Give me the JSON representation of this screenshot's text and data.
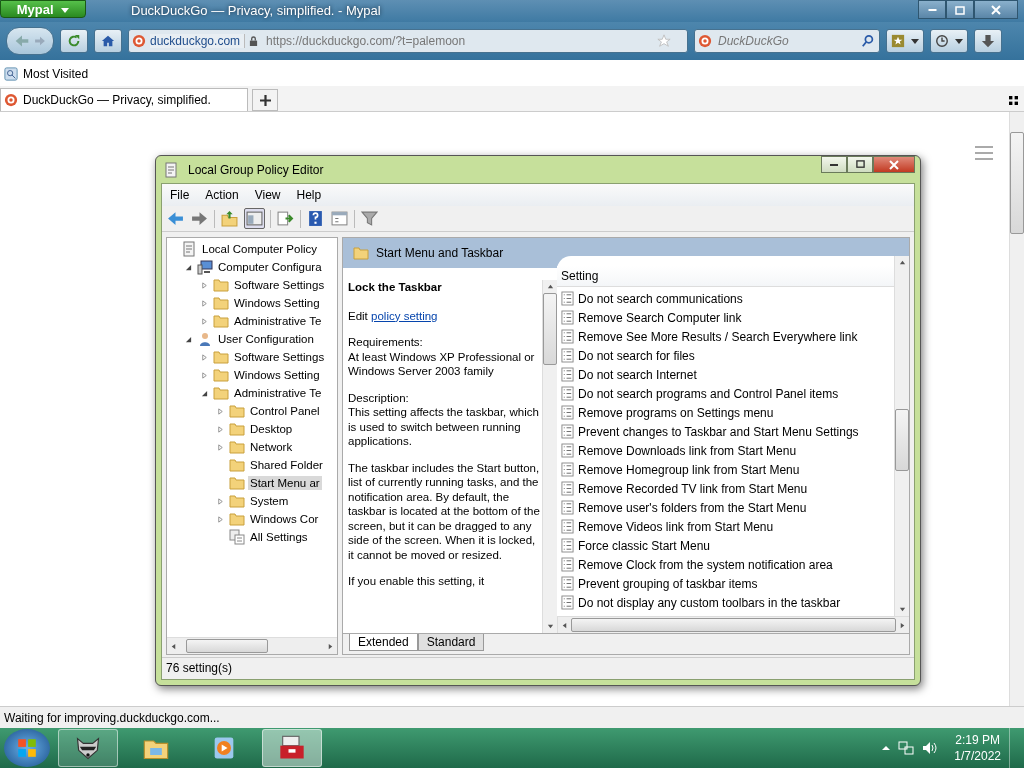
{
  "browser": {
    "app_button": "Mypal",
    "title": "DuckDuckGo — Privacy, simplified. - Mypal",
    "identity": "duckduckgo.com",
    "url": "https://duckduckgo.com/?t=palemoon",
    "search": {
      "placeholder": "DuckDuckGo"
    },
    "bookmarks": [
      "Most Visited"
    ],
    "tabs": [
      {
        "label": "DuckDuckGo — Privacy, simplified.",
        "selected": true
      }
    ],
    "status": "Waiting for improving.duckduckgo.com..."
  },
  "editor": {
    "title": "Local Group Policy Editor",
    "menu": [
      "File",
      "Action",
      "View",
      "Help"
    ],
    "tree": [
      {
        "label": "Local Computer Policy",
        "kind": "policy",
        "selected": false,
        "children": [
          {
            "label": "Computer Configura",
            "kind": "computer",
            "selected": false,
            "expanded": true,
            "children": [
              {
                "label": "Software Settings",
                "kind": "folder",
                "selected": false,
                "expanded": false
              },
              {
                "label": "Windows Setting",
                "kind": "folder",
                "selected": false,
                "expanded": false
              },
              {
                "label": "Administrative Te",
                "kind": "folder",
                "selected": false,
                "expanded": false
              }
            ]
          },
          {
            "label": "User Configuration",
            "kind": "user",
            "selected": false,
            "expanded": true,
            "children": [
              {
                "label": "Software Settings",
                "kind": "folder",
                "selected": false,
                "expanded": false
              },
              {
                "label": "Windows Setting",
                "kind": "folder",
                "selected": false,
                "expanded": false
              },
              {
                "label": "Administrative Te",
                "kind": "folder",
                "selected": false,
                "expanded": true,
                "children": [
                  {
                    "label": "Control Panel",
                    "kind": "folder",
                    "selected": false,
                    "expanded": false
                  },
                  {
                    "label": "Desktop",
                    "kind": "folder",
                    "selected": false,
                    "expanded": false
                  },
                  {
                    "label": "Network",
                    "kind": "folder",
                    "selected": false,
                    "expanded": false
                  },
                  {
                    "label": "Shared Folder",
                    "kind": "folder",
                    "selected": false
                  },
                  {
                    "label": "Start Menu ar",
                    "kind": "folder",
                    "selected": true
                  },
                  {
                    "label": "System",
                    "kind": "folder",
                    "selected": false,
                    "expanded": false
                  },
                  {
                    "label": "Windows Cor",
                    "kind": "folder",
                    "selected": false,
                    "expanded": false
                  },
                  {
                    "label": "All Settings",
                    "kind": "all-settings",
                    "selected": false
                  }
                ]
              }
            ]
          }
        ]
      }
    ],
    "header": "Start Menu and Taskbar",
    "description": {
      "heading": "Lock the Taskbar",
      "edit_prefix": "Edit",
      "edit_link": "policy setting",
      "requirements_label": "Requirements:",
      "requirements": "At least Windows XP Professional or Windows Server 2003 family",
      "description_label": "Description:",
      "paragraphs": [
        "This setting affects the taskbar, which is used to switch between running applications.",
        "The taskbar includes the Start button, list of currently running tasks, and the notification area. By default, the taskbar is located at the bottom of the screen, but it can be dragged to any side of the screen. When it is locked, it cannot be moved or resized.",
        "If you enable this setting, it"
      ]
    },
    "column": "Setting",
    "settings": [
      "Do not search communications",
      "Remove Search Computer link",
      "Remove See More Results / Search Everywhere link",
      "Do not search for files",
      "Do not search Internet",
      "Do not search programs and Control Panel items",
      "Remove programs on Settings menu",
      "Prevent changes to Taskbar and Start Menu Settings",
      "Remove Downloads link from Start Menu",
      "Remove Homegroup link from Start Menu",
      "Remove Recorded TV link from Start Menu",
      "Remove user's folders from the Start Menu",
      "Remove Videos link from Start Menu",
      "Force classic Start Menu",
      "Remove Clock from the system notification area",
      "Prevent grouping of taskbar items",
      "Do not display any custom toolbars in the taskbar"
    ],
    "view_tabs": [
      {
        "label": "Extended",
        "selected": true
      },
      {
        "label": "Standard",
        "selected": false
      }
    ],
    "status": "76 setting(s)"
  },
  "taskbar": {
    "apps": [
      {
        "kind": "raccoon",
        "open": true,
        "selected": false
      },
      {
        "kind": "folder",
        "open": false,
        "selected": false
      },
      {
        "kind": "media",
        "open": false,
        "selected": false
      },
      {
        "kind": "toolbox",
        "open": true,
        "selected": true
      }
    ],
    "time": "2:19 PM",
    "date": "1/7/2022"
  }
}
